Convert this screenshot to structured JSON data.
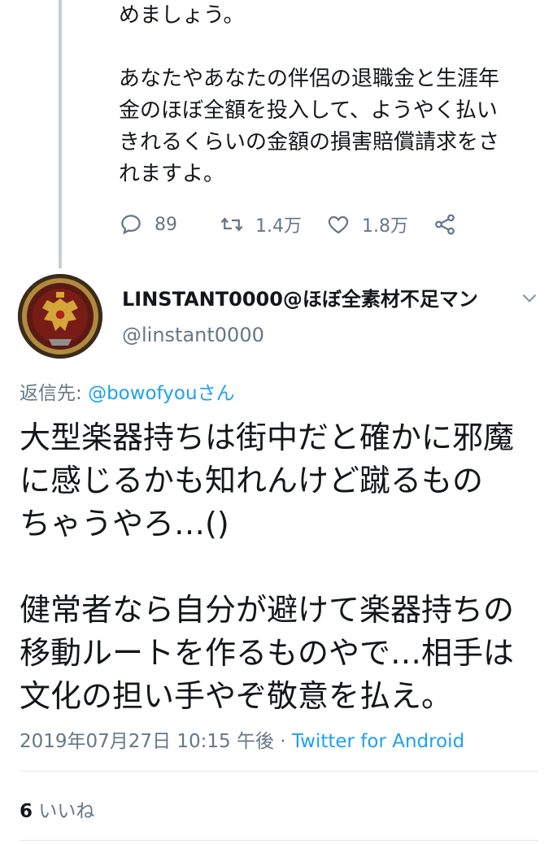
{
  "previous_tweet": {
    "lines_para1": "めましょう。",
    "lines_para2": "あなたやあなたの伴侶の退職金と生涯年\n金のほぼ全額を投入して、ようやく払い\nきれるくらいの金額の損害賠償請求をさ\nれますよ。",
    "reply_count": "89",
    "retweet_count": "1.4万",
    "like_count": "1.8万"
  },
  "tweet": {
    "display_name": "LINSTANT0000@ほぼ全素材不足マン",
    "handle": "@linstant0000",
    "replying_label": "返信先: ",
    "replying_to": "@bowofyouさん",
    "para1": "大型楽器持ちは街中だと確かに邪魔\nに感じるかも知れんけど蹴るもの\nちゃうやろ…()",
    "para2": "健常者なら自分が避けて楽器持ちの\n移動ルートを作るものやで…相手は\n文化の担い手やぞ敬意を払え。",
    "timestamp": "2019年07月27日 10:15 午後 · ",
    "source": "Twitter for Android",
    "likes_count": "6",
    "likes_label": " いいね"
  },
  "colors": {
    "text": "#14171a",
    "secondary": "#657786",
    "link": "#1da1f2",
    "thread_line": "#c4cfd6"
  }
}
